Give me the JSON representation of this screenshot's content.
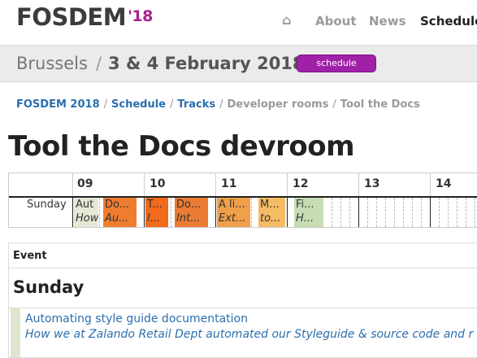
{
  "header": {
    "logo_text": "FOSDEM",
    "logo_year": "'18",
    "nav": {
      "home_icon": "home-icon",
      "about": "About",
      "news": "News",
      "schedule": "Schedule"
    }
  },
  "datebar": {
    "city": "Brussels",
    "separator": "/",
    "dates": "3 & 4 February 2018",
    "button": "schedule"
  },
  "breadcrumb": {
    "items": [
      "FOSDEM 2018",
      "Schedule",
      "Tracks",
      "Developer rooms",
      "Tool the Docs"
    ],
    "separator": "/"
  },
  "page_title": "Tool the Docs devroom",
  "timeline": {
    "hours": [
      "09",
      "10",
      "11",
      "12",
      "13",
      "14"
    ],
    "day": "Sunday",
    "events": [
      {
        "title": "Automating style guide documentation",
        "subtitle": "How we at Zalando Retail Dept automated our Styleguide",
        "short_title": "Aut",
        "short_sub": "How",
        "color": "#e6e8d6"
      },
      {
        "title": "Do",
        "subtitle": "Au",
        "short_title": "Do...",
        "short_sub": "Au...",
        "color": "#f07c30"
      },
      {
        "title": "T",
        "subtitle": "I",
        "short_title": "T...",
        "short_sub": "I...",
        "color": "#f26a1b"
      },
      {
        "title": "Do",
        "subtitle": "Int",
        "short_title": "Do...",
        "short_sub": "Int...",
        "color": "#ea7c34"
      },
      {
        "title": "A li",
        "subtitle": "Ext",
        "short_title": "A li...",
        "short_sub": "Ext...",
        "color": "#f0a04a"
      },
      {
        "title": "M",
        "subtitle": "to",
        "short_title": "M...",
        "short_sub": "to...",
        "color": "#f5bb65"
      },
      {
        "title": "Fi",
        "subtitle": "H",
        "short_title": "Fi...",
        "short_sub": "H...",
        "color": "#c5dcb4"
      }
    ]
  },
  "event_table": {
    "header": "Event",
    "day": "Sunday",
    "first_event_title": "Automating style guide documentation",
    "first_event_subtitle": "How we at Zalando Retail Dept automated our Styleguide & source code and r"
  }
}
